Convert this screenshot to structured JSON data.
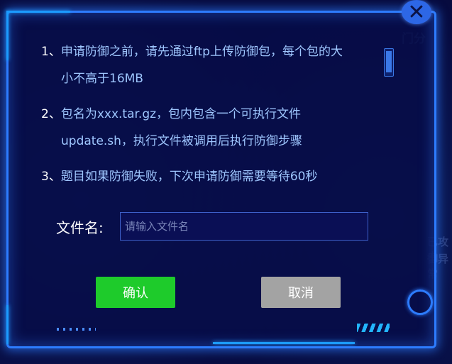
{
  "background": {
    "right_top_text": "门分",
    "right_mid_text_1": "已攻击",
    "right_mid_text_2": "御异常"
  },
  "dialog": {
    "close_icon": "close-icon",
    "instructions": [
      {
        "num": "1、",
        "line1": "申请防御之前，请先通过ftp上传防御包，每个包的大",
        "line2": "小不高于16MB"
      },
      {
        "num": "2、",
        "line1": "包名为xxx.tar.gz，包内包含一个可执行文件",
        "line2": "update.sh，执行文件被调用后执行防御步骤"
      },
      {
        "num": "3、",
        "line1": "题目如果防御失败，下次申请防御需要等待60秒",
        "line2": ""
      }
    ],
    "filename_label": "文件名:",
    "filename_placeholder": "请输入文件名",
    "filename_value": "",
    "confirm_label": "确认",
    "cancel_label": "取消"
  },
  "colors": {
    "frame": "#2d7cff",
    "text": "#9fc7ff",
    "confirm": "#1ecb2b",
    "cancel": "#a3a3a3"
  }
}
